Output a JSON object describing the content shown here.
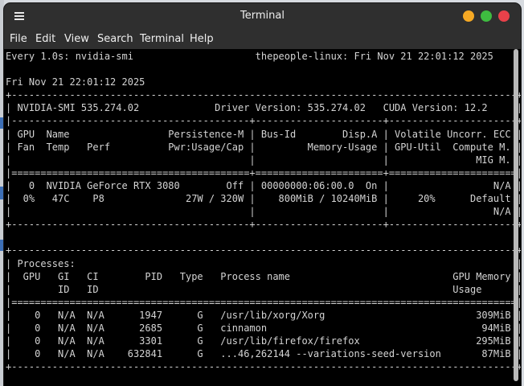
{
  "window": {
    "title": "Terminal",
    "controls": {
      "minimize_color": "#f6a924",
      "maximize_color": "#3ebc40",
      "close_color": "#e9414a"
    }
  },
  "menubar": {
    "items": [
      "File",
      "Edit",
      "View",
      "Search",
      "Terminal",
      "Help"
    ]
  },
  "terminal": {
    "lines": [
      "Every 1.0s: nvidia-smi                     thepeople-linux: Fri Nov 21 22:01:12 2025",
      "",
      "Fri Nov 21 22:01:12 2025",
      "+---------------------------------------------------------------------------------------+",
      "| NVIDIA-SMI 535.274.02             Driver Version: 535.274.02   CUDA Version: 12.2     |",
      "|-----------------------------------------+----------------------+----------------------+",
      "| GPU  Name                 Persistence-M | Bus-Id        Disp.A | Volatile Uncorr. ECC |",
      "| Fan  Temp   Perf          Pwr:Usage/Cap |         Memory-Usage | GPU-Util  Compute M. |",
      "|                                         |                      |               MIG M. |",
      "|=========================================+======================+======================|",
      "|   0  NVIDIA GeForce RTX 3080        Off | 00000000:06:00.0  On |                  N/A |",
      "|  0%   47C    P8              27W / 320W |    800MiB / 10240MiB |     20%      Default |",
      "|                                         |                      |                  N/A |",
      "+-----------------------------------------+----------------------+----------------------+",
      "",
      "+---------------------------------------------------------------------------------------+",
      "| Processes:                                                                            |",
      "|  GPU   GI   CI        PID   Type   Process name                            GPU Memory |",
      "|        ID   ID                                                             Usage      |",
      "|=======================================================================================|",
      "|    0   N/A  N/A      1947      G   /usr/lib/xorg/Xorg                          309MiB |",
      "|    0   N/A  N/A      2685      G   cinnamon                                     94MiB |",
      "|    0   N/A  N/A      3301      G   /usr/lib/firefox/firefox                    295MiB |",
      "|    0   N/A  N/A    632841      G   ...46,262144 --variations-seed-version       87MiB |",
      "+---------------------------------------------------------------------------------------+"
    ]
  }
}
